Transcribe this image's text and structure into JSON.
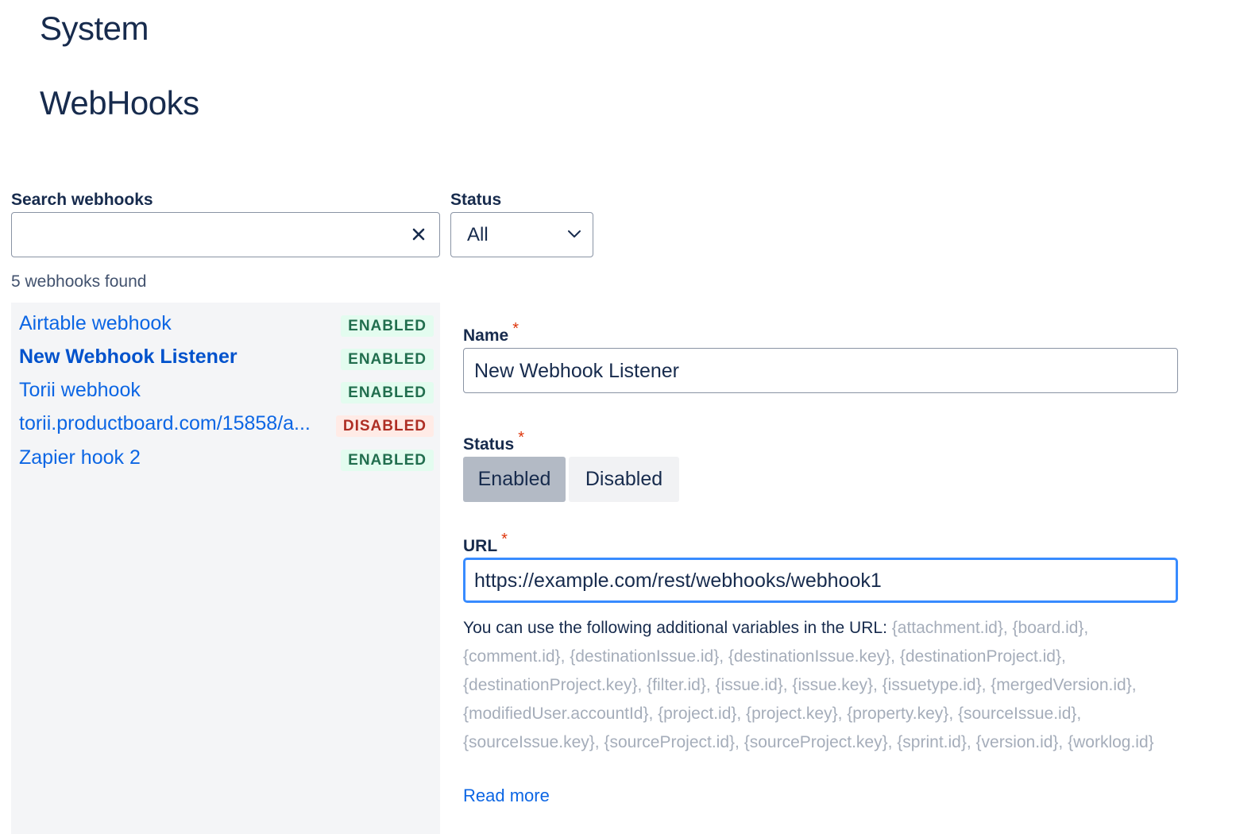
{
  "page": {
    "section_title": "System",
    "title": "WebHooks"
  },
  "filters": {
    "search_label": "Search webhooks",
    "search_value": "",
    "status_label": "Status",
    "status_value": "All"
  },
  "results": {
    "count_text": "5 webhooks found",
    "items": [
      {
        "name": "Airtable webhook",
        "status": "ENABLED"
      },
      {
        "name": "New Webhook Listener",
        "status": "ENABLED"
      },
      {
        "name": "Torii webhook",
        "status": "ENABLED"
      },
      {
        "name": "torii.productboard.com/15858/a...",
        "status": "DISABLED"
      },
      {
        "name": "Zapier hook 2",
        "status": "ENABLED"
      }
    ]
  },
  "form": {
    "name_label": "Name",
    "name_value": "New Webhook Listener",
    "status_label": "Status",
    "status_enabled": "Enabled",
    "status_disabled": "Disabled",
    "status_selected": "Enabled",
    "url_label": "URL",
    "url_value": "https://example.com/rest/webhooks/webhook1",
    "required_marker": "*",
    "help_intro": "You can use the following additional variables in the URL: ",
    "help_variables": "{attachment.id}, {board.id}, {comment.id}, {destinationIssue.id}, {destinationIssue.key}, {destinationProject.id}, {destinationProject.key}, {filter.id}, {issue.id}, {issue.key}, {issuetype.id}, {mergedVersion.id}, {modifiedUser.accountId}, {project.id}, {project.key}, {property.key}, {sourceIssue.id}, {sourceIssue.key}, {sourceProject.id}, {sourceProject.key}, {sprint.id}, {version.id}, {worklog.id}",
    "read_more": "Read more"
  },
  "colors": {
    "link": "#0c66e4",
    "enabled_badge_bg": "#e3fcef",
    "enabled_badge_text": "#216e4e",
    "disabled_badge_bg": "#ffebe6",
    "disabled_badge_text": "#ae2e24",
    "focus_ring": "#388bff"
  }
}
